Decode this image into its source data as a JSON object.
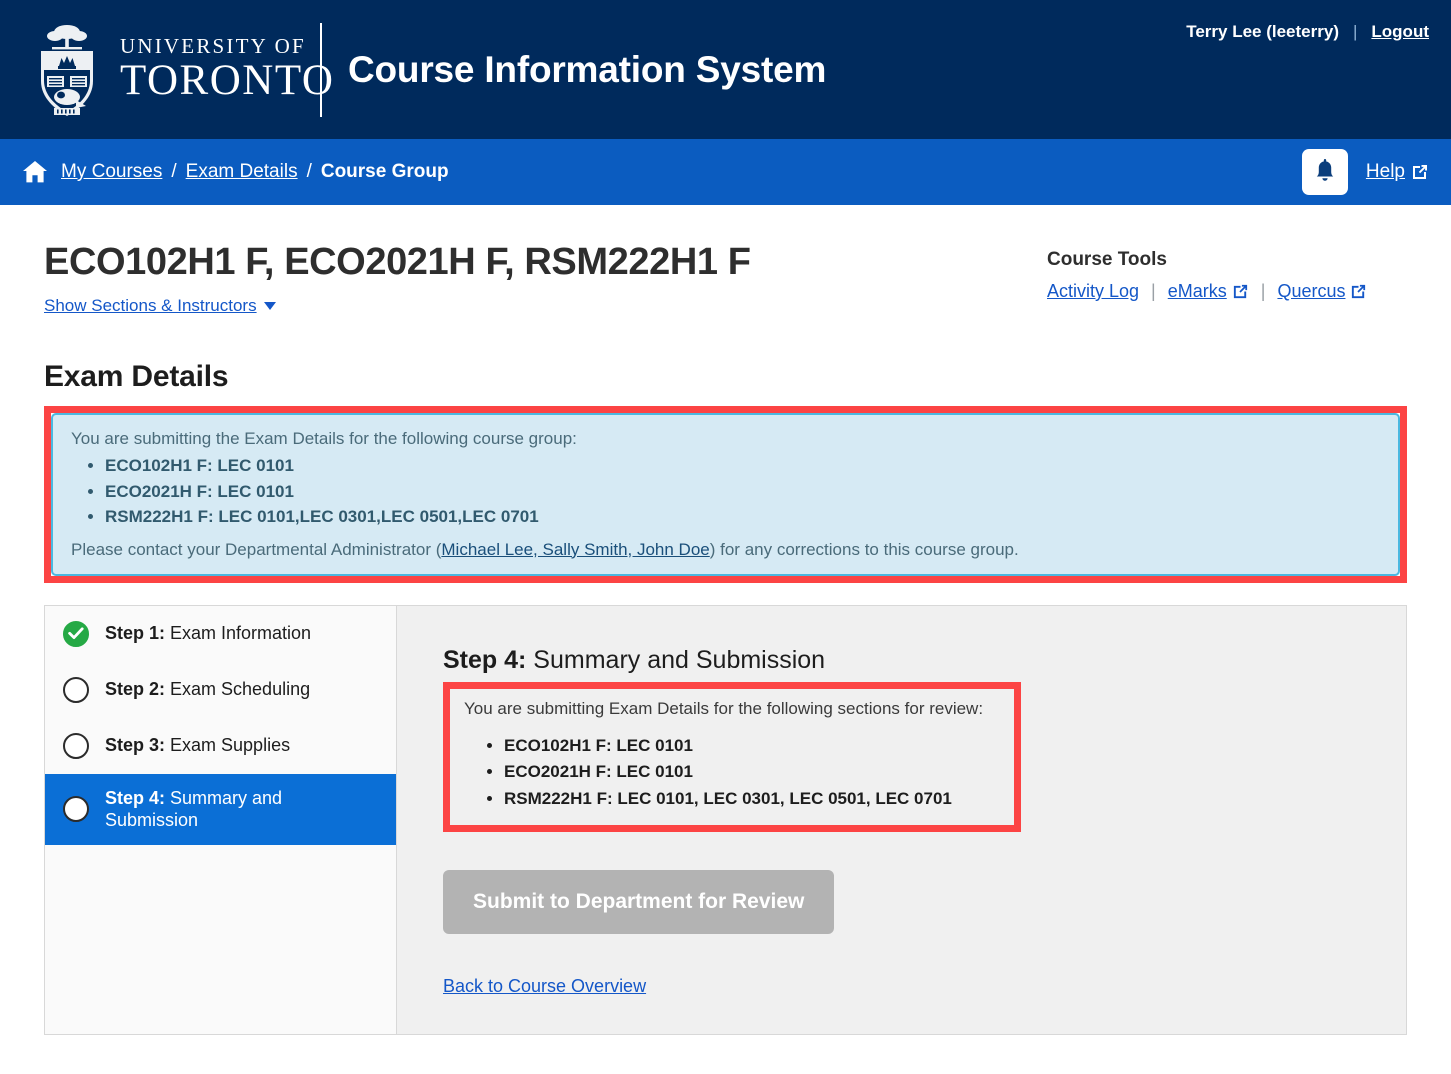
{
  "header": {
    "university_line1": "UNIVERSITY OF",
    "university_line2": "TORONTO",
    "app_title": "Course Information System",
    "user_name": "Terry Lee (leeterry)",
    "separator": "|",
    "logout_label": "Logout"
  },
  "breadcrumb": {
    "home_icon": "home-icon",
    "items": [
      {
        "label": "My Courses",
        "link": true
      },
      {
        "label": "Exam Details",
        "link": true
      },
      {
        "label": "Course Group",
        "link": false
      }
    ],
    "separator": "/",
    "bell_icon": "bell-icon",
    "help_label": "Help",
    "help_external_icon": "external-link-icon"
  },
  "page": {
    "title": "ECO102H1 F, ECO2021H F, RSM222H1 F",
    "show_sections_label": "Show Sections & Instructors",
    "section_heading": "Exam Details"
  },
  "course_tools": {
    "label": "Course Tools",
    "links": [
      {
        "label": "Activity Log",
        "external": false
      },
      {
        "label": "eMarks",
        "external": true
      },
      {
        "label": "Quercus",
        "external": true
      }
    ],
    "divider": "|"
  },
  "alert": {
    "lead": "You are submitting the Exam Details for the following course group:",
    "courses": [
      "ECO102H1 F: LEC 0101",
      "ECO2021H F: LEC 0101",
      "RSM222H1 F: LEC 0101,LEC 0301,LEC 0501,LEC 0701"
    ],
    "footer_before": "Please contact your Departmental Administrator (",
    "footer_link": "Michael Lee, Sally Smith, John Doe",
    "footer_after": ") for any corrections to this course group."
  },
  "wizard": {
    "steps": [
      {
        "num": "Step 1:",
        "name": " Exam Information",
        "state": "done"
      },
      {
        "num": "Step 2:",
        "name": " Exam Scheduling",
        "state": "todo"
      },
      {
        "num": "Step 3:",
        "name": " Exam Supplies",
        "state": "todo"
      },
      {
        "num": "Step 4:",
        "name": " Summary and Submission",
        "state": "active"
      }
    ]
  },
  "panel": {
    "heading_num": "Step 4:",
    "heading_name": " Summary and Submission",
    "summary_lead": "You are submitting Exam Details for the following sections for review:",
    "sections": [
      "ECO102H1 F: LEC 0101",
      "ECO2021H F: LEC 0101",
      "RSM222H1 F: LEC 0101, LEC 0301, LEC 0501, LEC 0701"
    ],
    "submit_label": "Submit to Department for Review",
    "back_label": "Back to Course Overview"
  },
  "colors": {
    "header_navy": "#002a5c",
    "breadcrumb_blue": "#0b5cc0",
    "accent_blue": "#1457c8",
    "alert_bg": "#d6eaf4",
    "alert_border": "#4bb8e0",
    "highlight_red": "#fc4444",
    "step_active": "#0b6fd6",
    "step_done_green": "#25a945",
    "disabled_gray": "#b3b3b3"
  }
}
